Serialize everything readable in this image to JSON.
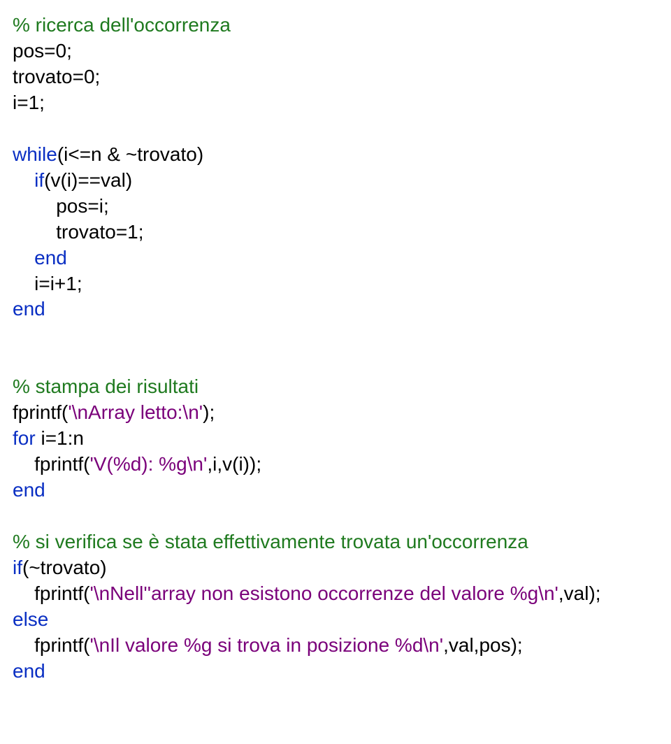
{
  "lines": [
    [
      {
        "cls": "comment",
        "text": "% ricerca dell'occorrenza"
      }
    ],
    [
      {
        "cls": "txt",
        "text": "pos=0;"
      }
    ],
    [
      {
        "cls": "txt",
        "text": "trovato=0;"
      }
    ],
    [
      {
        "cls": "txt",
        "text": "i=1;"
      }
    ],
    [
      {
        "cls": "txt",
        "text": ""
      }
    ],
    [
      {
        "cls": "kw",
        "text": "while"
      },
      {
        "cls": "txt",
        "text": "(i<=n & ~trovato)"
      }
    ],
    [
      {
        "cls": "txt",
        "text": "    "
      },
      {
        "cls": "kw",
        "text": "if"
      },
      {
        "cls": "txt",
        "text": "(v(i)==val)"
      }
    ],
    [
      {
        "cls": "txt",
        "text": "        pos=i;"
      }
    ],
    [
      {
        "cls": "txt",
        "text": "        trovato=1;"
      }
    ],
    [
      {
        "cls": "txt",
        "text": "    "
      },
      {
        "cls": "kw",
        "text": "end"
      }
    ],
    [
      {
        "cls": "txt",
        "text": "    i=i+1;"
      }
    ],
    [
      {
        "cls": "kw",
        "text": "end"
      }
    ],
    [
      {
        "cls": "txt",
        "text": ""
      }
    ],
    [
      {
        "cls": "txt",
        "text": ""
      }
    ],
    [
      {
        "cls": "comment",
        "text": "% stampa dei risultati"
      }
    ],
    [
      {
        "cls": "txt",
        "text": "fprintf("
      },
      {
        "cls": "str",
        "text": "'\\nArray letto:\\n'"
      },
      {
        "cls": "txt",
        "text": ");"
      }
    ],
    [
      {
        "cls": "kw",
        "text": "for"
      },
      {
        "cls": "txt",
        "text": " i=1:n"
      }
    ],
    [
      {
        "cls": "txt",
        "text": "    fprintf("
      },
      {
        "cls": "str",
        "text": "'V(%d): %g\\n'"
      },
      {
        "cls": "txt",
        "text": ",i,v(i));"
      }
    ],
    [
      {
        "cls": "kw",
        "text": "end"
      }
    ],
    [
      {
        "cls": "txt",
        "text": ""
      }
    ],
    [
      {
        "cls": "comment",
        "text": "% si verifica se è stata effettivamente trovata un'occorrenza"
      }
    ],
    [
      {
        "cls": "kw",
        "text": "if"
      },
      {
        "cls": "txt",
        "text": "(~trovato)"
      }
    ],
    [
      {
        "cls": "txt",
        "text": "    fprintf("
      },
      {
        "cls": "str",
        "text": "'\\nNell''array non esistono occorrenze del valore %g\\n'"
      },
      {
        "cls": "txt",
        "text": ",val);"
      }
    ],
    [
      {
        "cls": "kw",
        "text": "else"
      }
    ],
    [
      {
        "cls": "txt",
        "text": "    fprintf("
      },
      {
        "cls": "str",
        "text": "'\\nIl valore %g si trova in posizione %d\\n'"
      },
      {
        "cls": "txt",
        "text": ",val,pos);"
      }
    ],
    [
      {
        "cls": "kw",
        "text": "end"
      }
    ]
  ]
}
